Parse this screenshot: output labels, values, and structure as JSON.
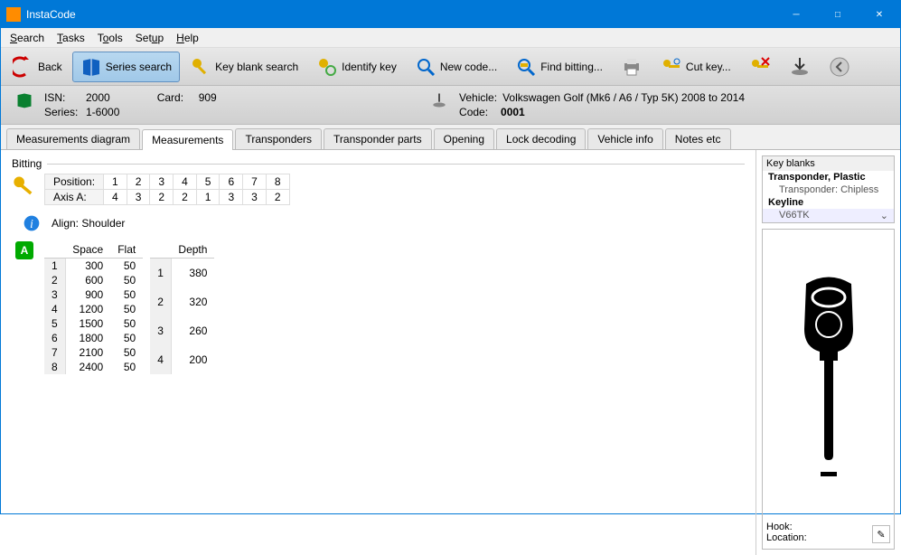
{
  "window": {
    "title": "InstaCode"
  },
  "menu": {
    "search": "Search",
    "tasks": "Tasks",
    "tools": "Tools",
    "setup": "Setup",
    "help": "Help"
  },
  "toolbar": {
    "back": "Back",
    "series_search": "Series search",
    "key_blank_search": "Key blank search",
    "identify_key": "Identify key",
    "new_code": "New code...",
    "find_bitting": "Find bitting...",
    "cut_key": "Cut key..."
  },
  "info": {
    "isn_label": "ISN:",
    "isn": "2000",
    "card_label": "Card:",
    "card": "909",
    "series_label": "Series:",
    "series": "1-6000",
    "vehicle_label": "Vehicle:",
    "vehicle": "Volkswagen Golf (Mk6 / A6 / Typ 5K) 2008 to 2014",
    "code_label": "Code:",
    "code": "0001"
  },
  "tabs": {
    "measurements_diagram": "Measurements diagram",
    "measurements": "Measurements",
    "transponders": "Transponders",
    "transponder_parts": "Transponder parts",
    "opening": "Opening",
    "lock_decoding": "Lock decoding",
    "vehicle_info": "Vehicle info",
    "notes_etc": "Notes etc"
  },
  "bitting": {
    "title": "Bitting",
    "position_label": "Position:",
    "positions": [
      "1",
      "2",
      "3",
      "4",
      "5",
      "6",
      "7",
      "8"
    ],
    "axis_label": "Axis A:",
    "axis_values": [
      "4",
      "3",
      "2",
      "2",
      "1",
      "3",
      "3",
      "2"
    ],
    "align_label": "Align:",
    "align_value": "Shoulder",
    "badge": "A"
  },
  "space_flat": {
    "headers": [
      "",
      "Space",
      "Flat"
    ],
    "rows": [
      [
        "1",
        "300",
        "50"
      ],
      [
        "2",
        "600",
        "50"
      ],
      [
        "3",
        "900",
        "50"
      ],
      [
        "4",
        "1200",
        "50"
      ],
      [
        "5",
        "1500",
        "50"
      ],
      [
        "6",
        "1800",
        "50"
      ],
      [
        "7",
        "2100",
        "50"
      ],
      [
        "8",
        "2400",
        "50"
      ]
    ]
  },
  "depth": {
    "headers": [
      "",
      "Depth"
    ],
    "rows": [
      [
        "1",
        "380"
      ],
      [
        "2",
        "320"
      ],
      [
        "3",
        "260"
      ],
      [
        "4",
        "200"
      ]
    ]
  },
  "key_blanks": {
    "title": "Key blanks",
    "items": [
      {
        "label": "Transponder, Plastic",
        "bold": true
      },
      {
        "label": "Transponder: Chipless",
        "sub": true
      },
      {
        "label": "Keyline",
        "bold": true
      },
      {
        "label": "V66TK",
        "sub": true,
        "sel": true,
        "chev": "⌄"
      }
    ]
  },
  "hook": {
    "hook_label": "Hook:",
    "location_label": "Location:"
  }
}
